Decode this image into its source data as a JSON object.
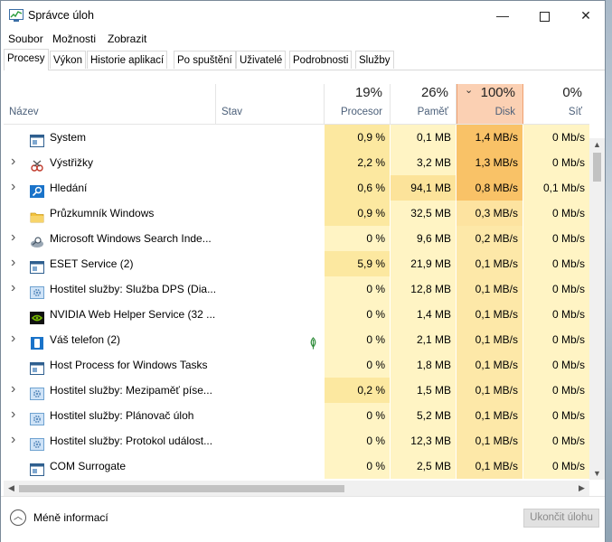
{
  "window": {
    "title": "Správce úloh",
    "min_glyph": "—",
    "close_glyph": "✕"
  },
  "menu": [
    "Soubor",
    "Možnosti",
    "Zobrazit"
  ],
  "tabs": [
    "Procesy",
    "Výkon",
    "Historie aplikací",
    "Po spuštění",
    "Uživatelé",
    "Podrobnosti",
    "Služby"
  ],
  "active_tab": "Procesy",
  "columns": {
    "name": "Název",
    "status": "Stav",
    "cpu": {
      "percent": "19%",
      "label": "Procesor"
    },
    "memory": {
      "percent": "26%",
      "label": "Paměť"
    },
    "disk": {
      "percent": "100%",
      "label": "Disk"
    },
    "network": {
      "percent": "0%",
      "label": "Síť"
    }
  },
  "processes": [
    {
      "name": "System",
      "expandable": false,
      "icon": "system-window-icon",
      "status": "",
      "cpu": "0,9 %",
      "memory": "0,1 MB",
      "disk": "1,4 MB/s",
      "network": "0 Mb/s"
    },
    {
      "name": "Výstřižky",
      "expandable": true,
      "icon": "snipping-tool-icon",
      "status": "",
      "cpu": "2,2 %",
      "memory": "3,2 MB",
      "disk": "1,3 MB/s",
      "network": "0 Mb/s"
    },
    {
      "name": "Hledání",
      "expandable": true,
      "icon": "search-icon",
      "status": "",
      "cpu": "0,6 %",
      "memory": "94,1 MB",
      "disk": "0,8 MB/s",
      "network": "0,1 Mb/s"
    },
    {
      "name": "Průzkumník Windows",
      "expandable": false,
      "icon": "folder-icon",
      "status": "",
      "cpu": "0,9 %",
      "memory": "32,5 MB",
      "disk": "0,3 MB/s",
      "network": "0 Mb/s"
    },
    {
      "name": "Microsoft Windows Search Inde...",
      "expandable": true,
      "icon": "search-indexer-icon",
      "status": "",
      "cpu": "0 %",
      "memory": "9,6 MB",
      "disk": "0,2 MB/s",
      "network": "0 Mb/s"
    },
    {
      "name": "ESET Service (2)",
      "expandable": true,
      "icon": "system-window-icon",
      "status": "",
      "cpu": "5,9 %",
      "memory": "21,9 MB",
      "disk": "0,1 MB/s",
      "network": "0 Mb/s"
    },
    {
      "name": "Hostitel služby: Služba DPS (Dia...",
      "expandable": true,
      "icon": "gear-icon",
      "status": "",
      "cpu": "0 %",
      "memory": "12,8 MB",
      "disk": "0,1 MB/s",
      "network": "0 Mb/s"
    },
    {
      "name": "NVIDIA Web Helper Service (32 ...",
      "expandable": false,
      "icon": "nvidia-icon",
      "status": "",
      "cpu": "0 %",
      "memory": "1,4 MB",
      "disk": "0,1 MB/s",
      "network": "0 Mb/s"
    },
    {
      "name": "Váš telefon (2)",
      "expandable": true,
      "icon": "phone-icon",
      "status": "",
      "cpu": "0 %",
      "memory": "2,1 MB",
      "disk": "0,1 MB/s",
      "network": "0 Mb/s",
      "suspended": true
    },
    {
      "name": "Host Process for Windows Tasks",
      "expandable": false,
      "icon": "system-window-icon",
      "status": "",
      "cpu": "0 %",
      "memory": "1,8 MB",
      "disk": "0,1 MB/s",
      "network": "0 Mb/s"
    },
    {
      "name": "Hostitel služby: Mezipaměť píse...",
      "expandable": true,
      "icon": "gear-icon",
      "status": "",
      "cpu": "0,2 %",
      "memory": "1,5 MB",
      "disk": "0,1 MB/s",
      "network": "0 Mb/s"
    },
    {
      "name": "Hostitel služby: Plánovač úloh",
      "expandable": true,
      "icon": "gear-icon",
      "status": "",
      "cpu": "0 %",
      "memory": "5,2 MB",
      "disk": "0,1 MB/s",
      "network": "0 Mb/s"
    },
    {
      "name": "Hostitel služby: Protokol událost...",
      "expandable": true,
      "icon": "gear-icon",
      "status": "",
      "cpu": "0 %",
      "memory": "12,3 MB",
      "disk": "0,1 MB/s",
      "network": "0 Mb/s"
    },
    {
      "name": "COM Surrogate",
      "expandable": false,
      "icon": "system-window-icon",
      "status": "",
      "cpu": "0 %",
      "memory": "2,5 MB",
      "disk": "0,1 MB/s",
      "network": "0 Mb/s"
    }
  ],
  "footer": {
    "less_details": "Méně informací",
    "end_task": "Ukončit úlohu"
  },
  "colors": {
    "heat_low": "#fff4c4",
    "heat_mid": "#fce8a0",
    "disk_header": "#fbd0b3",
    "disk_high": "#f9c267",
    "disk_mid": "#fbda8c",
    "disk_low": "#fde8a8",
    "header_label": "#4c607a"
  }
}
